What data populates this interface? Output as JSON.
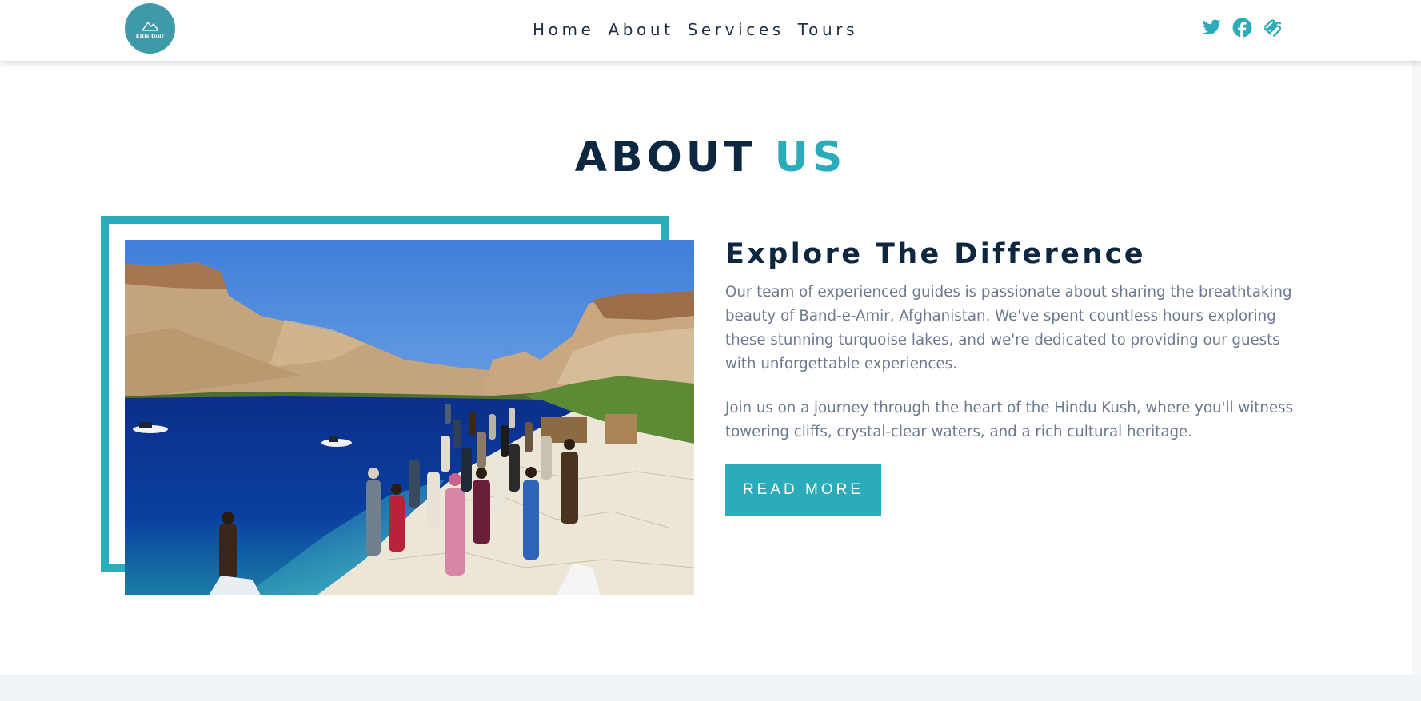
{
  "header": {
    "logo_text": "Ellis tour",
    "nav": [
      "Home",
      "About",
      "Services",
      "Tours"
    ],
    "social": [
      "twitter-icon",
      "facebook-icon",
      "squarespace-icon"
    ]
  },
  "about": {
    "title_main": "ABOUT",
    "title_accent": "US",
    "heading": "Explore The Difference",
    "paragraph1": "Our team of experienced guides is passionate about sharing the breathtaking beauty of Band-e-Amir, Afghanistan. We've spent countless hours exploring these stunning turquoise lakes, and we're dedicated to providing our guests with unforgettable experiences.",
    "paragraph2": "Join us on a journey through the heart of the Hindu Kush, where you'll witness towering cliffs, crystal-clear waters, and a rich cultural heritage.",
    "button": "READ MORE"
  },
  "colors": {
    "accent": "#2cacba",
    "dark": "#0e2740",
    "text": "#6b7a90",
    "logo_bg": "#3e9aa6"
  }
}
